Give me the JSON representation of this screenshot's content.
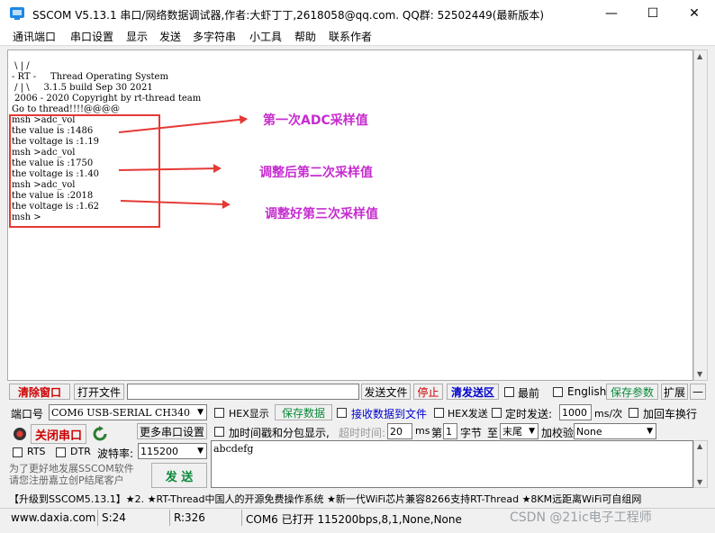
{
  "window": {
    "title": "SSCOM V5.13.1 串口/网络数据调试器,作者:大虾丁丁,2618058@qq.com. QQ群: 52502449(最新版本)",
    "minimize": "—",
    "maximize": "☐",
    "close": "✕"
  },
  "menu": [
    "通讯端口",
    "串口设置",
    "显示",
    "发送",
    "多字符串",
    "小工具",
    "帮助",
    "联系作者"
  ],
  "terminal": {
    "lines": [
      " \\ | /",
      "- RT -     Thread Operating System",
      " / | \\     3.1.5 build Sep 30 2021",
      " 2006 - 2020 Copyright by rt-thread team",
      "Go to thread!!!!@@@@",
      "msh >adc_vol",
      "the value is :1486",
      "the voltage is :1.19",
      "msh >adc_vol",
      "the value is :1750",
      "the voltage is :1.40",
      "msh >adc_vol",
      "the value is :2018",
      "the voltage is :1.62",
      "msh >"
    ]
  },
  "annotations": [
    "第一次ADC采样值",
    "调整后第二次采样值",
    "调整好第三次采样值"
  ],
  "toolbar": {
    "clear_window": "清除窗口",
    "open_file": "打开文件",
    "send_file": "发送文件",
    "stop": "停止",
    "clear_send": "清发送区",
    "topmost": "最前",
    "english": "English",
    "save_params": "保存参数",
    "expand": "扩展",
    "collapse": "—"
  },
  "port": {
    "label": "端口号",
    "value": "COM6 USB-SERIAL CH340",
    "hex_display": "HEX显示",
    "save_data": "保存数据",
    "receive_to_file": "接收数据到文件",
    "hex_send": "HEX发送",
    "timed_send": "定时发送:",
    "interval": "1000",
    "interval_unit": "ms/次",
    "add_crlf": "加回车换行"
  },
  "connection": {
    "close_port": "关闭串口",
    "more_settings": "更多串口设置",
    "timestamp": "加时间戳和分包显示,",
    "timeout_label": "超时时间:",
    "timeout_value": "20",
    "timeout_unit": "ms",
    "byte_prefix": "第",
    "byte_index": "1",
    "byte_label": "字节",
    "to_label": "至",
    "tail": "末尾",
    "checksum_label": "加校验",
    "checksum_value": "None"
  },
  "serial": {
    "rts": "RTS",
    "dtr": "DTR",
    "baud_label": "波特率:",
    "baud_value": "115200"
  },
  "send": {
    "promo": "为了更好地发展SSCOM软件\n请您注册嘉立创P结尾客户",
    "button": "发 送",
    "text": "abcdefg"
  },
  "ticker": "【升级到SSCOM5.13.1】★2. ★RT-Thread中国人的开源免费操作系统 ★新一代WiFi芯片兼容8266支持RT-Thread ★8KM远距离WiFi可自组网",
  "status": {
    "website": "www.daxia.com",
    "sent": "S:24",
    "received": "R:326",
    "port_state": "COM6 已打开  115200bps,8,1,None,None",
    "watermark": "CSDN @21ic电子工程师"
  }
}
